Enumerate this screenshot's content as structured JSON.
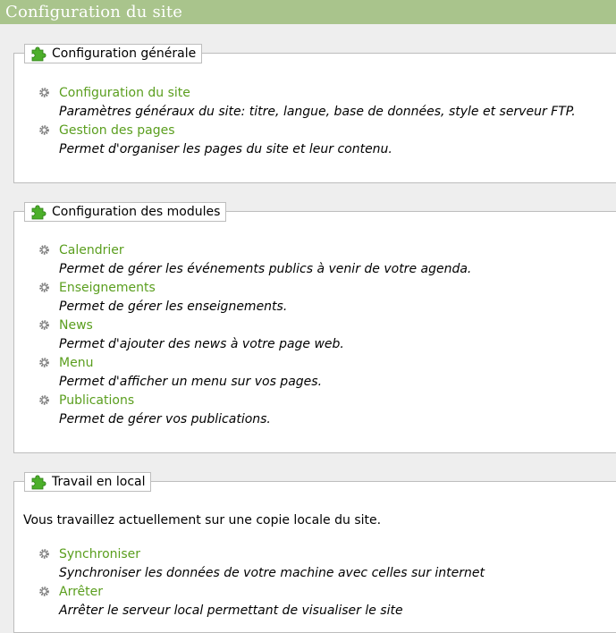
{
  "page": {
    "title": "Configuration du site"
  },
  "sections": [
    {
      "legend": "Configuration générale",
      "entries": [
        {
          "label": "Configuration du site",
          "description": "Paramètres généraux du site: titre, langue, base de données, style et serveur FTP."
        },
        {
          "label": "Gestion des pages",
          "description": "Permet d'organiser les pages du site et leur contenu."
        }
      ]
    },
    {
      "legend": "Configuration des modules",
      "entries": [
        {
          "label": "Calendrier",
          "description": "Permet de gérer les événements publics à venir de votre agenda."
        },
        {
          "label": "Enseignements",
          "description": "Permet de gérer les enseignements."
        },
        {
          "label": "News",
          "description": "Permet d'ajouter des news à votre page web."
        },
        {
          "label": "Menu",
          "description": "Permet d'afficher un menu sur vos pages."
        },
        {
          "label": "Publications",
          "description": "Permet de gérer vos publications."
        }
      ]
    },
    {
      "legend": "Travail en local",
      "intro": "Vous travaillez actuellement sur une copie locale du site.",
      "entries": [
        {
          "label": "Synchroniser",
          "description": "Synchroniser les données de votre machine avec celles sur internet"
        },
        {
          "label": "Arrêter",
          "description": "Arrêter le serveur local permettant de visualiser le site"
        }
      ]
    }
  ],
  "colors": {
    "titlebar": "#a9c48c",
    "link": "#5a9e1e",
    "icon_green": "#4caf2a"
  },
  "icons": {
    "section": "puzzle-piece-icon",
    "entry": "gear-icon"
  }
}
